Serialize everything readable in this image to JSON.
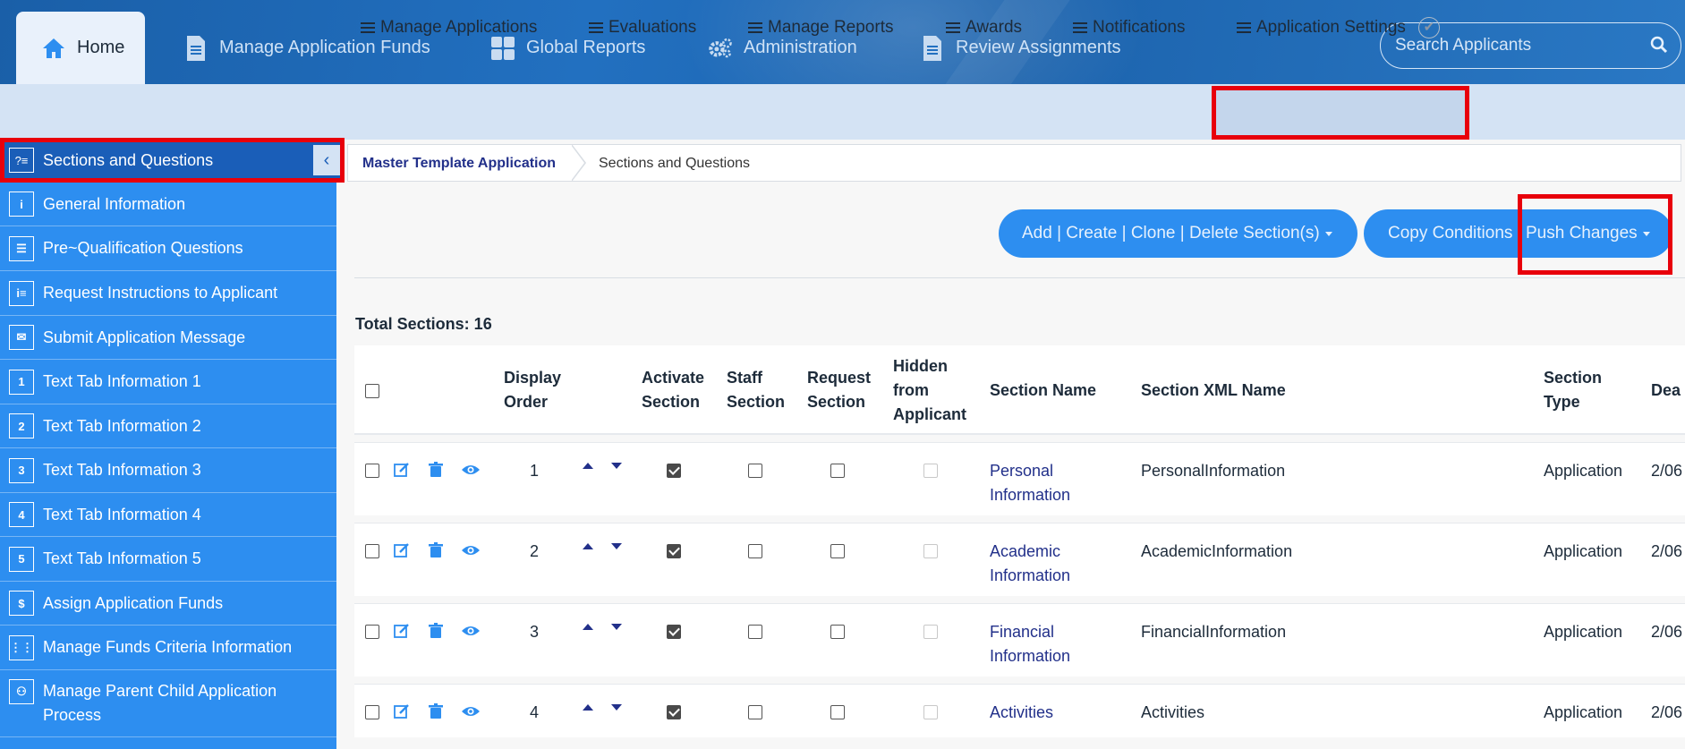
{
  "topnav": {
    "tabs": [
      {
        "label": "Home",
        "icon": "home-icon"
      },
      {
        "label": "Manage Application Funds",
        "icon": "document-icon"
      },
      {
        "label": "Global Reports",
        "icon": "grid-icon"
      },
      {
        "label": "Administration",
        "icon": "gears-icon"
      },
      {
        "label": "Review Assignments",
        "icon": "document-icon"
      }
    ],
    "search_placeholder": "Search Applicants"
  },
  "subnav": {
    "items": [
      "Manage Applications",
      "Evaluations",
      "Manage Reports",
      "Awards",
      "Notifications",
      "Application Settings"
    ]
  },
  "sidebar": {
    "header": "Sections and Questions",
    "items": [
      {
        "label": "General Information",
        "icon": "info-icon"
      },
      {
        "label": "Pre~Qualification Questions",
        "icon": "checklist-icon"
      },
      {
        "label": "Request Instructions to Applicant",
        "icon": "instructions-icon"
      },
      {
        "label": "Submit Application Message",
        "icon": "envelope-icon"
      },
      {
        "label": "Text Tab Information 1",
        "icon": "number-1-icon"
      },
      {
        "label": "Text Tab Information 2",
        "icon": "number-2-icon"
      },
      {
        "label": "Text Tab Information 3",
        "icon": "number-3-icon"
      },
      {
        "label": "Text Tab Information 4",
        "icon": "number-4-icon"
      },
      {
        "label": "Text Tab Information 5",
        "icon": "number-5-icon"
      },
      {
        "label": "Assign Application Funds",
        "icon": "funds-icon"
      },
      {
        "label": "Manage Funds Criteria Information",
        "icon": "criteria-icon"
      },
      {
        "label": "Manage Parent Child Application Process",
        "icon": "parent-child-icon"
      }
    ]
  },
  "breadcrumb": {
    "parent": "Master Template Application",
    "current": "Sections and Questions"
  },
  "actions": {
    "sections_button": "Add | Create | Clone | Delete Section(s)",
    "copy_button": "Copy Conditions",
    "push_button": "Push Changes"
  },
  "total_sections": "Total Sections: 16",
  "table": {
    "headers": {
      "display_order": [
        "Display",
        "Order"
      ],
      "activate": [
        "Activate",
        "Section"
      ],
      "staff": [
        "Staff",
        "Section"
      ],
      "request": [
        "Request",
        "Section"
      ],
      "hidden": [
        "Hidden",
        "from",
        "Applicant"
      ],
      "name": "Section Name",
      "xml": "Section XML Name",
      "type": [
        "Section",
        "Type"
      ],
      "deadline": "Dea"
    },
    "rows": [
      {
        "order": "1",
        "activate": true,
        "staff": false,
        "request": false,
        "hidden": false,
        "name": [
          "Personal",
          "Information"
        ],
        "xml": "PersonalInformation",
        "type": "Application",
        "date": "2/06"
      },
      {
        "order": "2",
        "activate": true,
        "staff": false,
        "request": false,
        "hidden": false,
        "name": [
          "Academic",
          "Information"
        ],
        "xml": "AcademicInformation",
        "type": "Application",
        "date": "2/06"
      },
      {
        "order": "3",
        "activate": true,
        "staff": false,
        "request": false,
        "hidden": false,
        "name": [
          "Financial",
          "Information"
        ],
        "xml": "FinancialInformation",
        "type": "Application",
        "date": "2/06"
      },
      {
        "order": "4",
        "activate": true,
        "staff": false,
        "request": false,
        "hidden": false,
        "name": [
          "Activities"
        ],
        "xml": "Activities",
        "type": "Application",
        "date": "2/06"
      }
    ]
  }
}
